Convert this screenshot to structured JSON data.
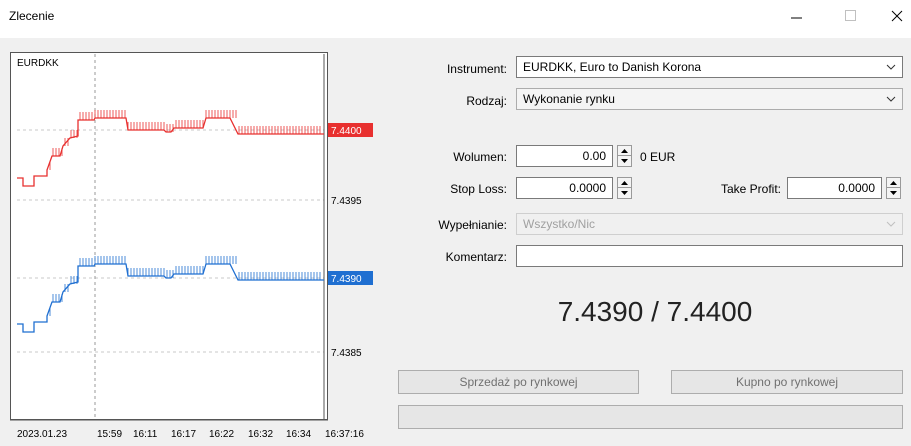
{
  "window": {
    "title": "Zlecenie",
    "controls": {
      "minimize_icon": "minimize-icon",
      "maximize_icon": "maximize-icon",
      "close_icon": "close-icon"
    }
  },
  "chart": {
    "symbol": "EURDKK",
    "price_labels": [
      "7.4400",
      "7.4395",
      "7.4390",
      "7.4385"
    ],
    "time_labels": [
      "2023.01.23",
      "15:59",
      "16:11",
      "16:17",
      "16:22",
      "16:32",
      "16:34",
      "16:37:16"
    ],
    "ask_color": "#e8302f",
    "bid_color": "#1f6fd1",
    "ask_value": 7.44,
    "bid_value": 7.439
  },
  "form": {
    "instrument": {
      "label": "Instrument:",
      "value": "EURDKK, Euro to Danish Korona"
    },
    "type": {
      "label": "Rodzaj:",
      "value": "Wykonanie rynku"
    },
    "volume": {
      "label": "Wolumen:",
      "value": "0.00",
      "unit": "0 EUR"
    },
    "stop_loss": {
      "label": "Stop Loss:",
      "value": "0.0000"
    },
    "take_profit": {
      "label": "Take Profit:",
      "value": "0.0000"
    },
    "filling": {
      "label": "Wypełnianie:",
      "value": "Wszystko/Nic"
    },
    "comment": {
      "label": "Komentarz:",
      "value": ""
    }
  },
  "quote": {
    "text": "7.4390 / 7.4400"
  },
  "buttons": {
    "sell": "Sprzedaż po rynkowej",
    "buy": "Kupno po rynkowej",
    "status": ""
  }
}
